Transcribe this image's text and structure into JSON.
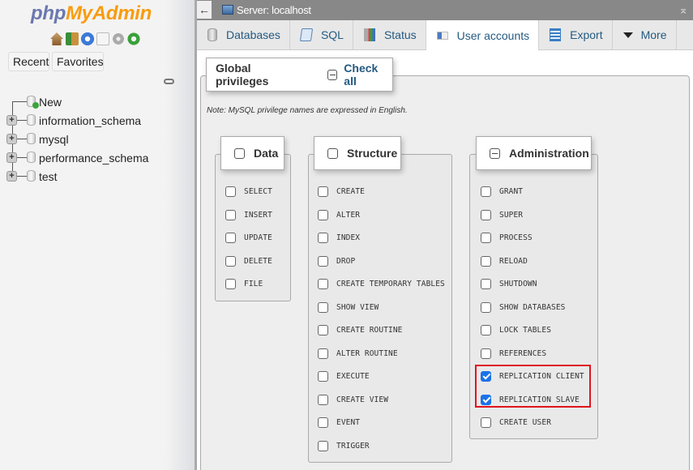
{
  "sidebar": {
    "logo_php": "php",
    "logo_myadmin": "MyAdmin",
    "quick_icons": [
      "home-icon",
      "logout-icon",
      "help-icon",
      "docs-icon",
      "settings-icon",
      "reload-icon"
    ],
    "recent_label": "Recent",
    "favorites_label": "Favorites",
    "tree": [
      {
        "label": "New",
        "icon": "new-database-icon"
      },
      {
        "label": "information_schema",
        "icon": "database-icon"
      },
      {
        "label": "mysql",
        "icon": "database-icon"
      },
      {
        "label": "performance_schema",
        "icon": "database-icon"
      },
      {
        "label": "test",
        "icon": "database-icon"
      }
    ]
  },
  "breadcrumb": {
    "server_label": "Server: localhost"
  },
  "tabs": [
    {
      "label": "Databases",
      "icon": "database-icon",
      "active": false
    },
    {
      "label": "SQL",
      "icon": "sql-icon",
      "active": false
    },
    {
      "label": "Status",
      "icon": "status-icon",
      "active": false
    },
    {
      "label": "User accounts",
      "icon": "user-accounts-icon",
      "active": true
    },
    {
      "label": "Export",
      "icon": "export-icon",
      "active": false
    },
    {
      "label": "More",
      "icon": "triangle-down-icon",
      "active": false
    }
  ],
  "privileges": {
    "title": "Global privileges",
    "check_all_label": "Check all",
    "note": "Note: MySQL privilege names are expressed in English.",
    "groups": [
      {
        "label": "Data",
        "state": "unchecked",
        "items": [
          {
            "label": "SELECT",
            "checked": false
          },
          {
            "label": "INSERT",
            "checked": false
          },
          {
            "label": "UPDATE",
            "checked": false
          },
          {
            "label": "DELETE",
            "checked": false
          },
          {
            "label": "FILE",
            "checked": false
          }
        ]
      },
      {
        "label": "Structure",
        "state": "unchecked",
        "items": [
          {
            "label": "CREATE",
            "checked": false
          },
          {
            "label": "ALTER",
            "checked": false
          },
          {
            "label": "INDEX",
            "checked": false
          },
          {
            "label": "DROP",
            "checked": false
          },
          {
            "label": "CREATE TEMPORARY TABLES",
            "checked": false
          },
          {
            "label": "SHOW VIEW",
            "checked": false
          },
          {
            "label": "CREATE ROUTINE",
            "checked": false
          },
          {
            "label": "ALTER ROUTINE",
            "checked": false
          },
          {
            "label": "EXECUTE",
            "checked": false
          },
          {
            "label": "CREATE VIEW",
            "checked": false
          },
          {
            "label": "EVENT",
            "checked": false
          },
          {
            "label": "TRIGGER",
            "checked": false
          }
        ]
      },
      {
        "label": "Administration",
        "state": "indeterminate",
        "items": [
          {
            "label": "GRANT",
            "checked": false
          },
          {
            "label": "SUPER",
            "checked": false
          },
          {
            "label": "PROCESS",
            "checked": false
          },
          {
            "label": "RELOAD",
            "checked": false
          },
          {
            "label": "SHUTDOWN",
            "checked": false
          },
          {
            "label": "SHOW DATABASES",
            "checked": false
          },
          {
            "label": "LOCK TABLES",
            "checked": false
          },
          {
            "label": "REFERENCES",
            "checked": false
          },
          {
            "label": "REPLICATION CLIENT",
            "checked": true
          },
          {
            "label": "REPLICATION SLAVE",
            "checked": true
          },
          {
            "label": "CREATE USER",
            "checked": false
          }
        ]
      }
    ]
  },
  "colors": {
    "link": "#235a81",
    "checked": "#1a73e8",
    "highlight": "#e0141e"
  }
}
